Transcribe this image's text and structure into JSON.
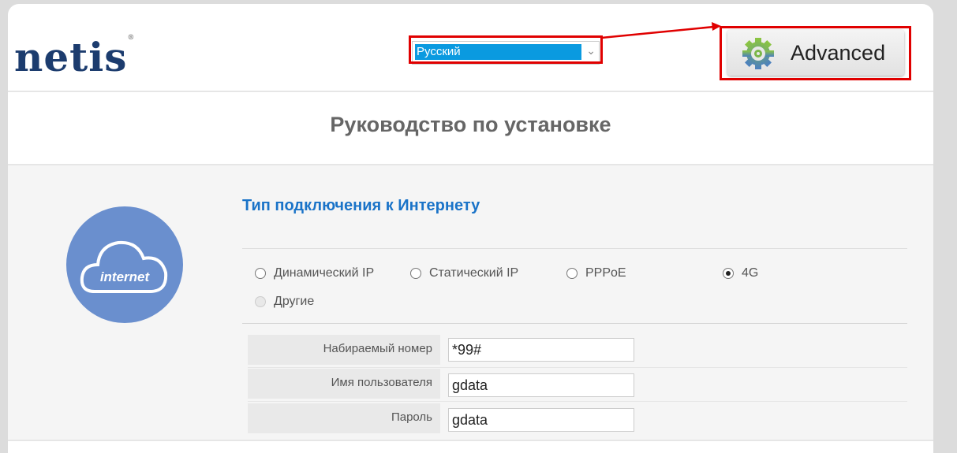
{
  "header": {
    "logo": "netis",
    "language_selected": "Русский",
    "advanced_label": "Advanced"
  },
  "page_title": "Руководство по установке",
  "section": {
    "title": "Тип подключения к Интернету",
    "icon_label": "internet",
    "connection_types": [
      {
        "label": "Динамический IP",
        "selected": false,
        "disabled": false
      },
      {
        "label": "Статический IP",
        "selected": false,
        "disabled": false
      },
      {
        "label": "PPPoE",
        "selected": false,
        "disabled": false
      },
      {
        "label": "4G",
        "selected": true,
        "disabled": false
      },
      {
        "label": "Другие",
        "selected": false,
        "disabled": true
      }
    ],
    "fields": [
      {
        "label": "Набираемый номер",
        "value": "*99#"
      },
      {
        "label": "Имя пользователя",
        "value": "gdata"
      },
      {
        "label": "Пароль",
        "value": "gdata"
      }
    ]
  },
  "colors": {
    "accent": "#1a73c8",
    "highlight": "#0a9ae0",
    "annotation": "#e00000"
  }
}
